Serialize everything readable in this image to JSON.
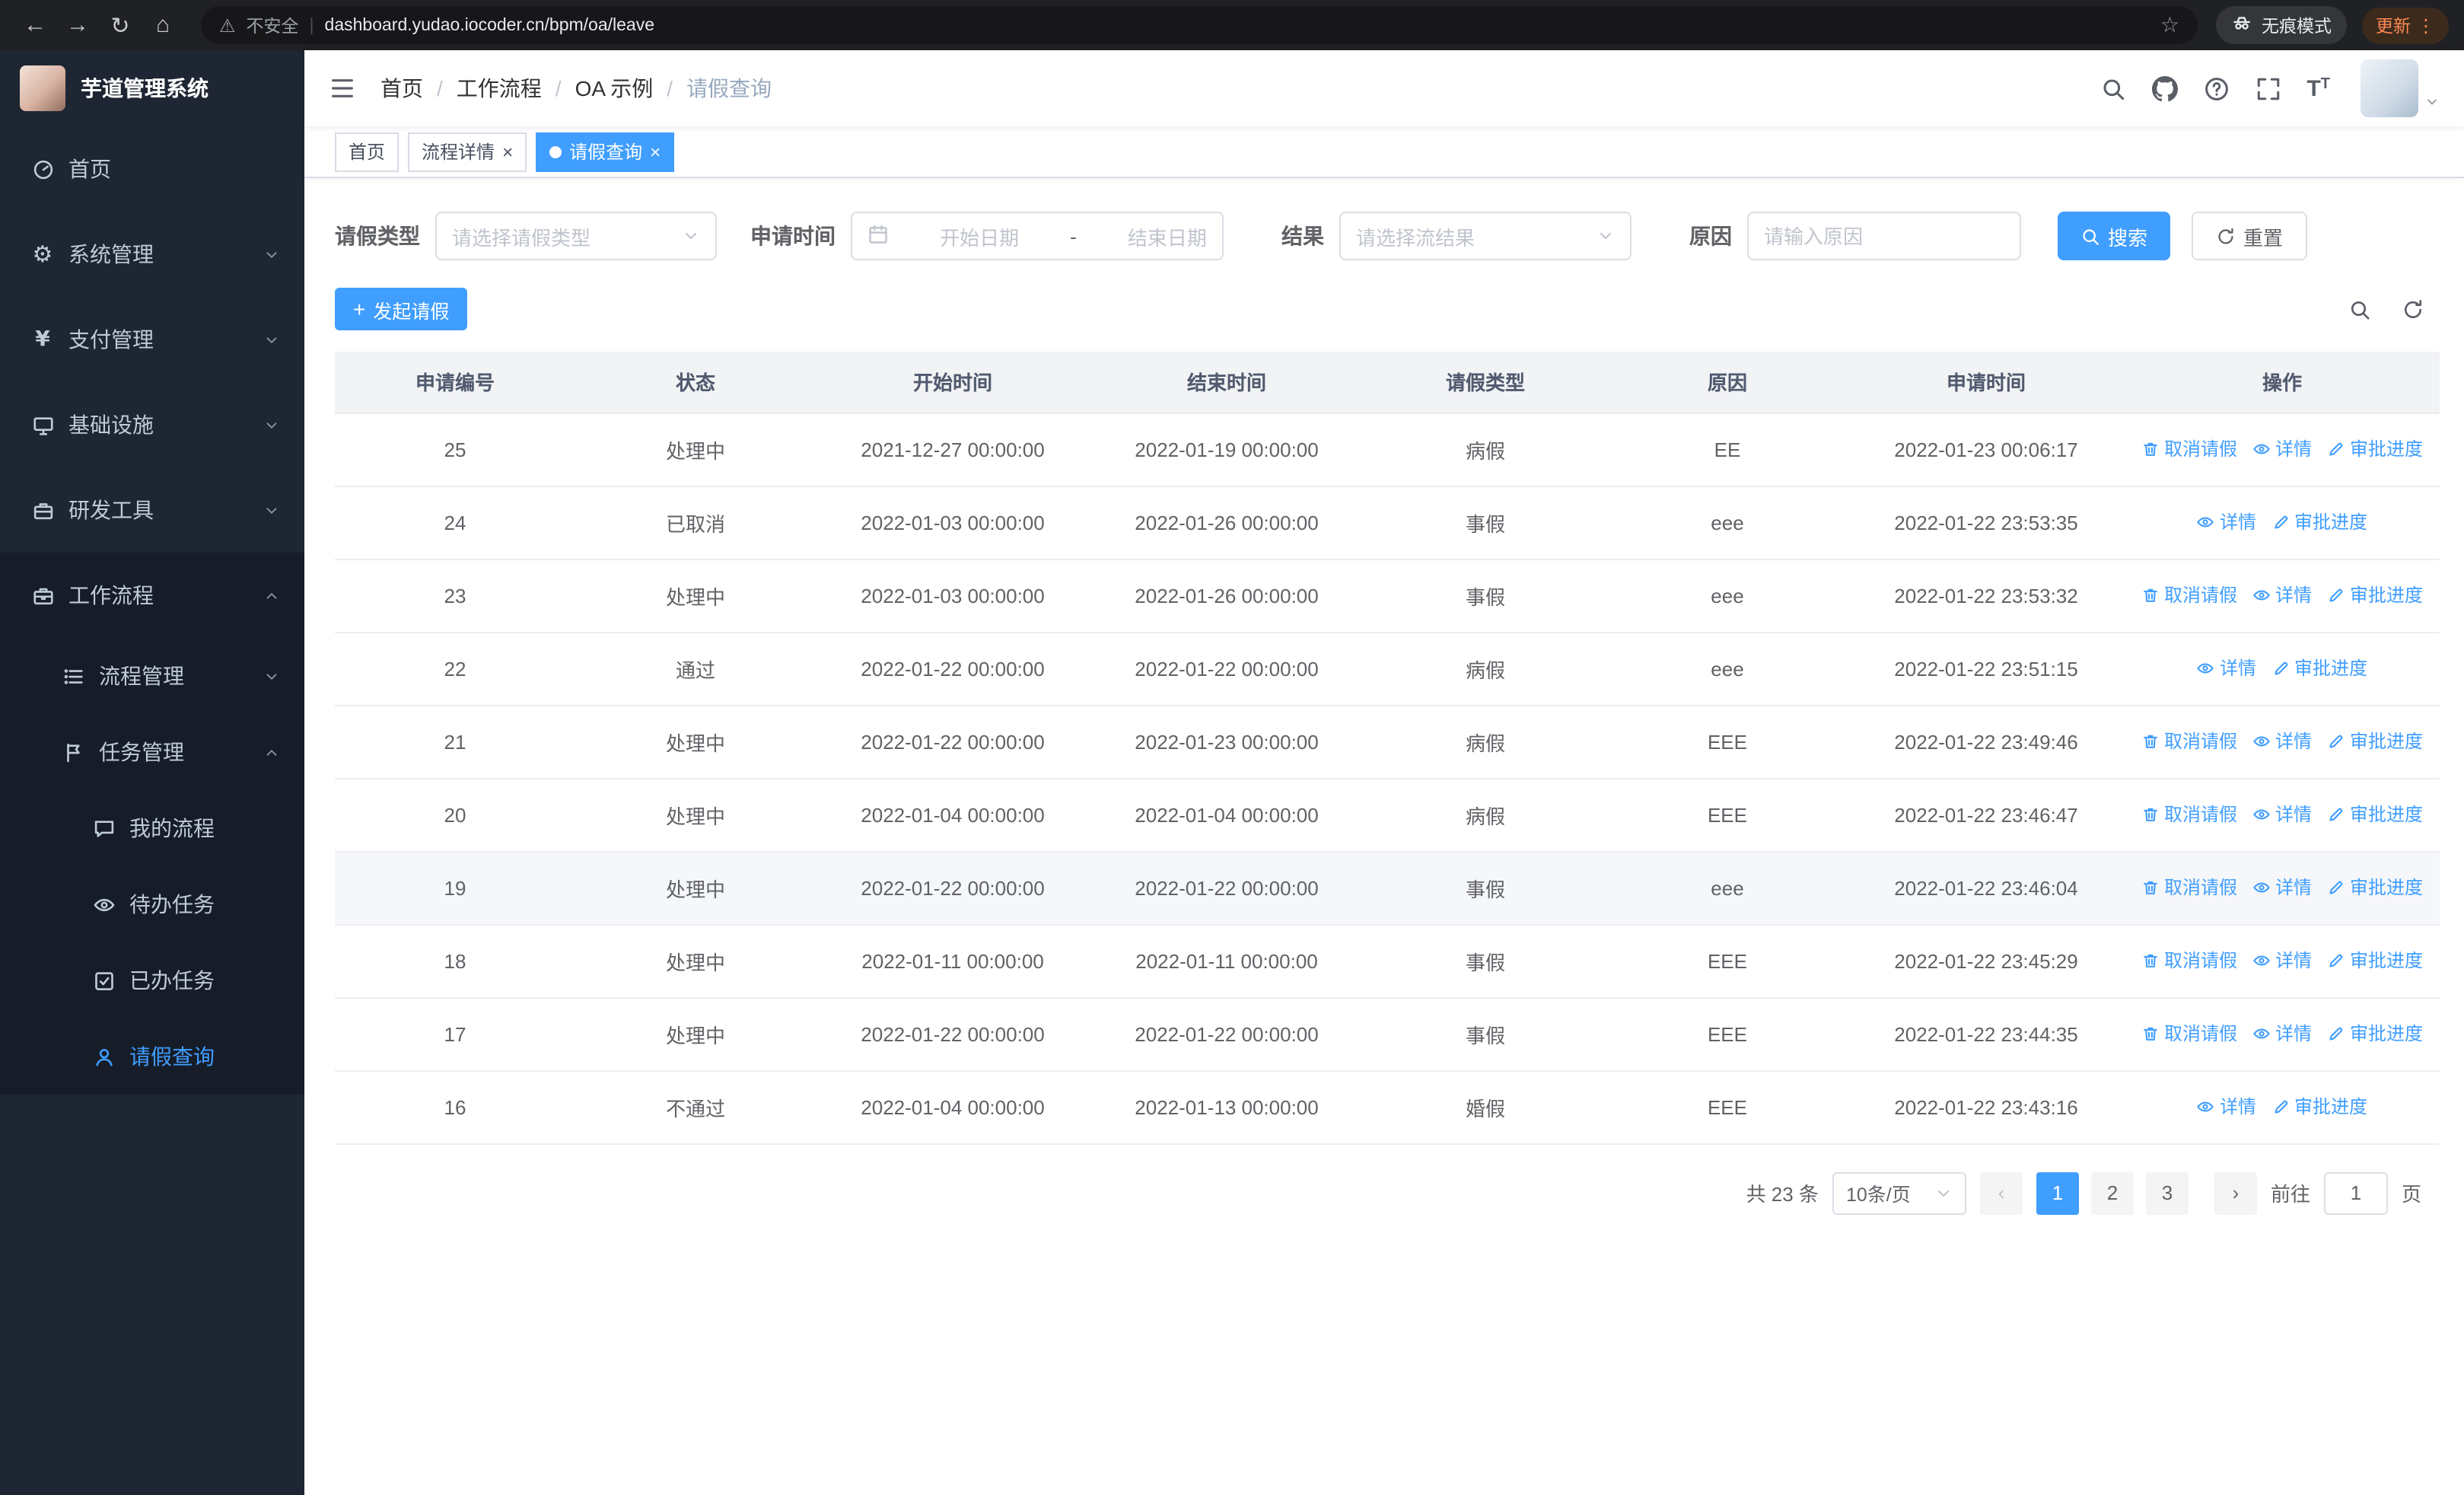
{
  "browser": {
    "security_label": "不安全",
    "url": "dashboard.yudao.iocoder.cn/bpm/oa/leave",
    "incognito_label": "无痕模式",
    "update_label": "更新"
  },
  "sidebar": {
    "logo_title": "芋道管理系统",
    "items": [
      {
        "key": "home",
        "label": "首页",
        "icon": "dashboard-icon",
        "level": 1
      },
      {
        "key": "system-management",
        "label": "系统管理",
        "icon": "gear-icon",
        "level": 1,
        "chevron": "down"
      },
      {
        "key": "payment-management",
        "label": "支付管理",
        "icon": "yen-icon",
        "level": 1,
        "chevron": "down"
      },
      {
        "key": "infrastructure",
        "label": "基础设施",
        "icon": "infra-icon",
        "level": 1,
        "chevron": "down"
      },
      {
        "key": "dev-tools",
        "label": "研发工具",
        "icon": "tool-icon",
        "level": 1,
        "chevron": "down"
      },
      {
        "key": "workflow",
        "label": "工作流程",
        "icon": "workflow-icon",
        "level": 1,
        "chevron": "up",
        "dark": true
      },
      {
        "key": "process-management",
        "label": "流程管理",
        "icon": "process-icon",
        "level": 2,
        "chevron": "down",
        "dark": true
      },
      {
        "key": "task-management",
        "label": "任务管理",
        "icon": "task-icon",
        "level": 2,
        "chevron": "up",
        "dark": true
      },
      {
        "key": "my-process",
        "label": "我的流程",
        "icon": "chat-icon",
        "level": 3,
        "dark": true
      },
      {
        "key": "todo-tasks",
        "label": "待办任务",
        "icon": "eye-icon",
        "level": 3,
        "dark": true
      },
      {
        "key": "done-tasks",
        "label": "已办任务",
        "icon": "check-icon",
        "level": 3,
        "dark": true
      },
      {
        "key": "leave-query",
        "label": "请假查询",
        "icon": "user-icon",
        "level": 3,
        "dark": true,
        "active": true
      }
    ]
  },
  "breadcrumb": {
    "items": [
      "首页",
      "工作流程",
      "OA 示例",
      "请假查询"
    ]
  },
  "tabs": [
    {
      "key": "home",
      "label": "首页",
      "closable": false,
      "active": false
    },
    {
      "key": "process-detail",
      "label": "流程详情",
      "closable": true,
      "active": false
    },
    {
      "key": "leave-query",
      "label": "请假查询",
      "closable": true,
      "active": true
    }
  ],
  "filters": {
    "leave_type_label": "请假类型",
    "leave_type_placeholder": "请选择请假类型",
    "apply_time_label": "申请时间",
    "start_placeholder": "开始日期",
    "range_separator": "-",
    "end_placeholder": "结束日期",
    "result_label": "结果",
    "result_placeholder": "请选择流结果",
    "reason_label": "原因",
    "reason_placeholder": "请输入原因",
    "search_label": "搜索",
    "reset_label": "重置"
  },
  "toolbar": {
    "create_label": "发起请假"
  },
  "table": {
    "columns": [
      "申请编号",
      "状态",
      "开始时间",
      "结束时间",
      "请假类型",
      "原因",
      "申请时间",
      "操作"
    ],
    "action_labels": {
      "cancel": "取消请假",
      "detail": "详情",
      "progress": "审批进度"
    },
    "rows": [
      {
        "id": "25",
        "status": "处理中",
        "start_time": "2021-12-27 00:00:00",
        "end_time": "2022-01-19 00:00:00",
        "leave_type": "病假",
        "reason": "EE",
        "apply_time": "2022-01-23 00:06:17",
        "actions": [
          "cancel",
          "detail",
          "progress"
        ]
      },
      {
        "id": "24",
        "status": "已取消",
        "start_time": "2022-01-03 00:00:00",
        "end_time": "2022-01-26 00:00:00",
        "leave_type": "事假",
        "reason": "eee",
        "apply_time": "2022-01-22 23:53:35",
        "actions": [
          "detail",
          "progress"
        ]
      },
      {
        "id": "23",
        "status": "处理中",
        "start_time": "2022-01-03 00:00:00",
        "end_time": "2022-01-26 00:00:00",
        "leave_type": "事假",
        "reason": "eee",
        "apply_time": "2022-01-22 23:53:32",
        "actions": [
          "cancel",
          "detail",
          "progress"
        ]
      },
      {
        "id": "22",
        "status": "通过",
        "start_time": "2022-01-22 00:00:00",
        "end_time": "2022-01-22 00:00:00",
        "leave_type": "病假",
        "reason": "eee",
        "apply_time": "2022-01-22 23:51:15",
        "actions": [
          "detail",
          "progress"
        ]
      },
      {
        "id": "21",
        "status": "处理中",
        "start_time": "2022-01-22 00:00:00",
        "end_time": "2022-01-23 00:00:00",
        "leave_type": "病假",
        "reason": "EEE",
        "apply_time": "2022-01-22 23:49:46",
        "actions": [
          "cancel",
          "detail",
          "progress"
        ]
      },
      {
        "id": "20",
        "status": "处理中",
        "start_time": "2022-01-04 00:00:00",
        "end_time": "2022-01-04 00:00:00",
        "leave_type": "病假",
        "reason": "EEE",
        "apply_time": "2022-01-22 23:46:47",
        "actions": [
          "cancel",
          "detail",
          "progress"
        ]
      },
      {
        "id": "19",
        "status": "处理中",
        "start_time": "2022-01-22 00:00:00",
        "end_time": "2022-01-22 00:00:00",
        "leave_type": "事假",
        "reason": "eee",
        "apply_time": "2022-01-22 23:46:04",
        "actions": [
          "cancel",
          "detail",
          "progress"
        ],
        "highlighted": true
      },
      {
        "id": "18",
        "status": "处理中",
        "start_time": "2022-01-11 00:00:00",
        "end_time": "2022-01-11 00:00:00",
        "leave_type": "事假",
        "reason": "EEE",
        "apply_time": "2022-01-22 23:45:29",
        "actions": [
          "cancel",
          "detail",
          "progress"
        ]
      },
      {
        "id": "17",
        "status": "处理中",
        "start_time": "2022-01-22 00:00:00",
        "end_time": "2022-01-22 00:00:00",
        "leave_type": "事假",
        "reason": "EEE",
        "apply_time": "2022-01-22 23:44:35",
        "actions": [
          "cancel",
          "detail",
          "progress"
        ]
      },
      {
        "id": "16",
        "status": "不通过",
        "start_time": "2022-01-04 00:00:00",
        "end_time": "2022-01-13 00:00:00",
        "leave_type": "婚假",
        "reason": "EEE",
        "apply_time": "2022-01-22 23:43:16",
        "actions": [
          "detail",
          "progress"
        ]
      }
    ]
  },
  "pagination": {
    "total_label": "共 23 条",
    "page_size_label": "10条/页",
    "pages": [
      {
        "label": "1",
        "active": true
      },
      {
        "label": "2",
        "active": false
      },
      {
        "label": "3",
        "active": false
      }
    ],
    "goto_prefix": "前往",
    "goto_value": "1",
    "goto_suffix": "页"
  },
  "colors": {
    "primary": "#409EFF",
    "sidebar_bg": "#1e2633",
    "sidebar_sub_bg": "#161c28"
  }
}
